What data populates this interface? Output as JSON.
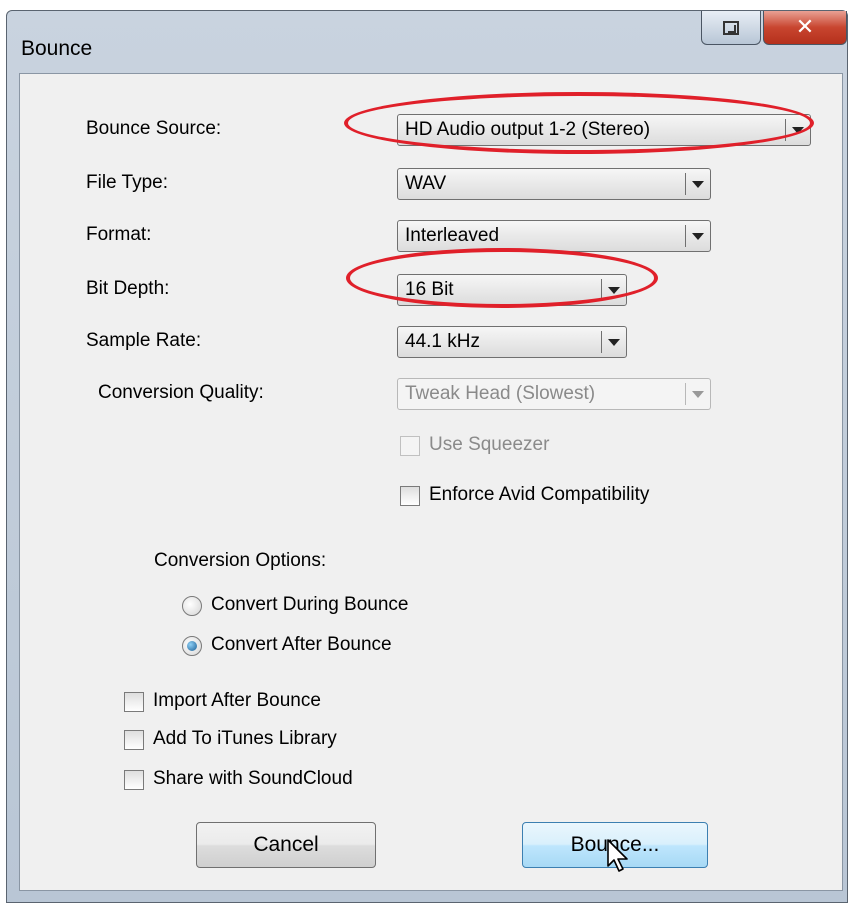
{
  "window": {
    "title": "Bounce"
  },
  "fields": {
    "bounce_source": {
      "label": "Bounce Source:",
      "value": "HD Audio output 1-2 (Stereo)"
    },
    "file_type": {
      "label": "File Type:",
      "value": "WAV"
    },
    "format": {
      "label": "Format:",
      "value": "Interleaved"
    },
    "bit_depth": {
      "label": "Bit Depth:",
      "value": "16 Bit"
    },
    "sample_rate": {
      "label": "Sample Rate:",
      "value": "44.1 kHz"
    },
    "conversion_quality": {
      "label": "Conversion Quality:",
      "value": "Tweak Head (Slowest)"
    }
  },
  "options": {
    "use_squeezer": {
      "label": "Use Squeezer",
      "checked": false,
      "enabled": false
    },
    "enforce_avid": {
      "label": "Enforce Avid Compatibility",
      "checked": false
    }
  },
  "conversion_options": {
    "heading": "Conversion Options:",
    "during": {
      "label": "Convert During Bounce",
      "selected": false
    },
    "after": {
      "label": "Convert After Bounce",
      "selected": true
    }
  },
  "post": {
    "import_after": {
      "label": "Import After Bounce",
      "checked": false
    },
    "add_itunes": {
      "label": "Add To iTunes Library",
      "checked": false
    },
    "share_soundcloud": {
      "label": "Share with SoundCloud",
      "checked": false
    }
  },
  "buttons": {
    "cancel": "Cancel",
    "bounce": "Bounce..."
  },
  "colors": {
    "annotation": "#e0202a",
    "default_button": "#bee6fd",
    "dialog_bg": "#f0f0f0"
  }
}
